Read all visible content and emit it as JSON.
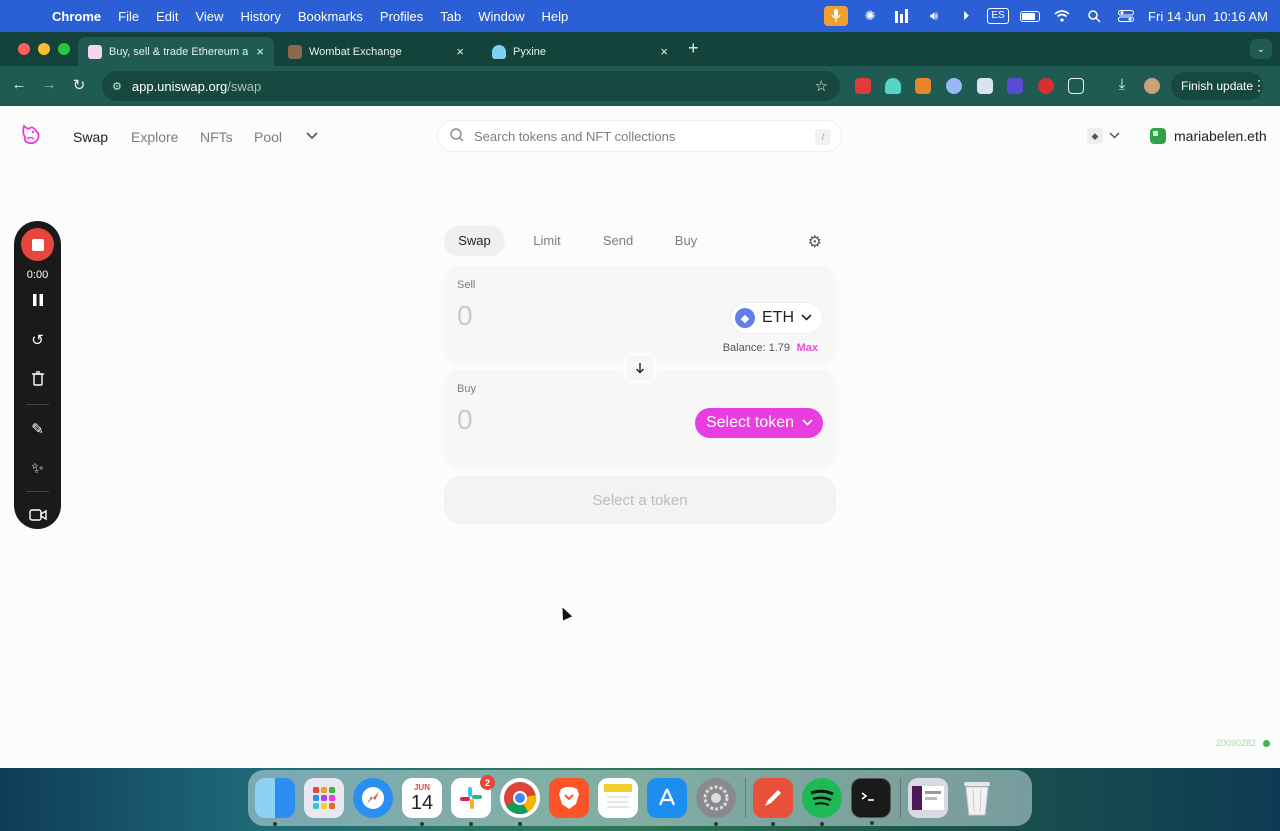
{
  "menubar": {
    "app_name": "Chrome",
    "items": [
      "File",
      "Edit",
      "View",
      "History",
      "Bookmarks",
      "Profiles",
      "Tab",
      "Window",
      "Help"
    ],
    "input_source": "ES",
    "datetime": "Fri 14 Jun  10:16 AM"
  },
  "browser": {
    "tabs": [
      {
        "title": "Buy, sell & trade Ethereum an",
        "favicon_color": "#f3d6f0"
      },
      {
        "title": "Wombat Exchange",
        "favicon_color": "#8a6a4a"
      },
      {
        "title": "Pyxine",
        "favicon_color": "#7fd1f0"
      }
    ],
    "url_domain": "app.uniswap.org",
    "url_path": "/swap",
    "finish_update_label": "Finish update"
  },
  "uniswap": {
    "nav": [
      "Swap",
      "Explore",
      "NFTs",
      "Pool"
    ],
    "search_placeholder": "Search tokens and NFT collections",
    "search_shortcut": "/",
    "account_name": "mariabelen.eth",
    "swap_tabs": [
      "Swap",
      "Limit",
      "Send",
      "Buy"
    ],
    "sell": {
      "label": "Sell",
      "amount": "0",
      "token": "ETH",
      "balance_text": "Balance: 1.79",
      "max_label": "Max"
    },
    "buy": {
      "label": "Buy",
      "amount": "0",
      "select_label": "Select token"
    },
    "action_button": "Select a token",
    "build_id": "20090282"
  },
  "recorder": {
    "time": "0:00"
  },
  "dock": {
    "calendar_month": "JUN",
    "calendar_day": "14",
    "slack_badge": "2"
  },
  "colors": {
    "accent_pink": "#e93de2",
    "chrome_tabbar": "#14433c",
    "chrome_toolbar": "#1f5b52",
    "menubar": "#2a5fd6"
  }
}
